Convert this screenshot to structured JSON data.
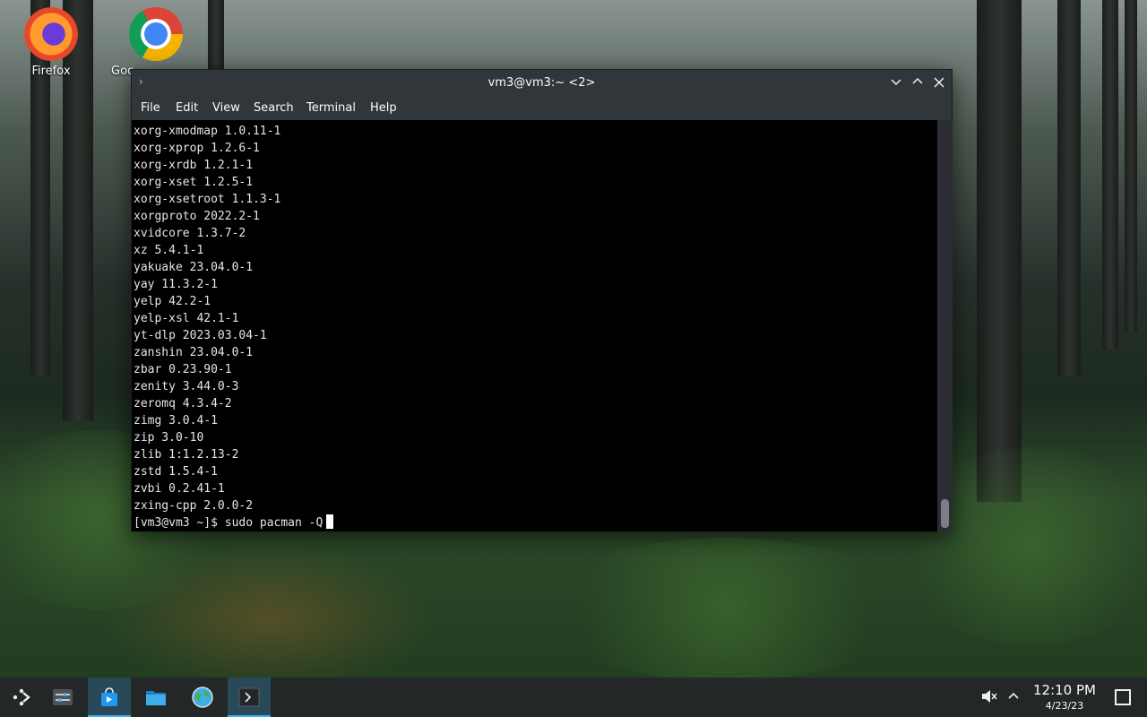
{
  "desktop": {
    "icons": [
      {
        "label": "Firefox",
        "icon": "firefox-icon"
      },
      {
        "label": "Goo",
        "icon": "chrome-icon"
      }
    ]
  },
  "window": {
    "title": "vm3@vm3:~ <2>",
    "menus": [
      "File",
      "Edit",
      "View",
      "Search",
      "Terminal",
      "Help"
    ],
    "buttons": {
      "minimize": "⌵",
      "maximize": "⌃",
      "close": "✕"
    }
  },
  "terminal": {
    "lines": [
      "xorg-xmodmap 1.0.11-1",
      "xorg-xprop 1.2.6-1",
      "xorg-xrdb 1.2.1-1",
      "xorg-xset 1.2.5-1",
      "xorg-xsetroot 1.1.3-1",
      "xorgproto 2022.2-1",
      "xvidcore 1.3.7-2",
      "xz 5.4.1-1",
      "yakuake 23.04.0-1",
      "yay 11.3.2-1",
      "yelp 42.2-1",
      "yelp-xsl 42.1-1",
      "yt-dlp 2023.03.04-1",
      "zanshin 23.04.0-1",
      "zbar 0.23.90-1",
      "zenity 3.44.0-3",
      "zeromq 4.3.4-2",
      "zimg 3.0.4-1",
      "zip 3.0-10",
      "zlib 1:1.2.13-2",
      "zstd 1.5.4-1",
      "zvbi 0.2.41-1",
      "zxing-cpp 2.0.0-2"
    ],
    "prompt": "[vm3@vm3 ~]$ sudo pacman -Q"
  },
  "taskbar": {
    "items": [
      "app-launcher-icon",
      "system-settings-icon",
      "discover-icon",
      "file-manager-icon",
      "web-browser-icon",
      "konsole-icon"
    ],
    "clock": {
      "time": "12:10 PM",
      "date": "4/23/23"
    },
    "tray": [
      "volume-muted-icon",
      "tray-expand-icon",
      "show-desktop-icon"
    ]
  }
}
